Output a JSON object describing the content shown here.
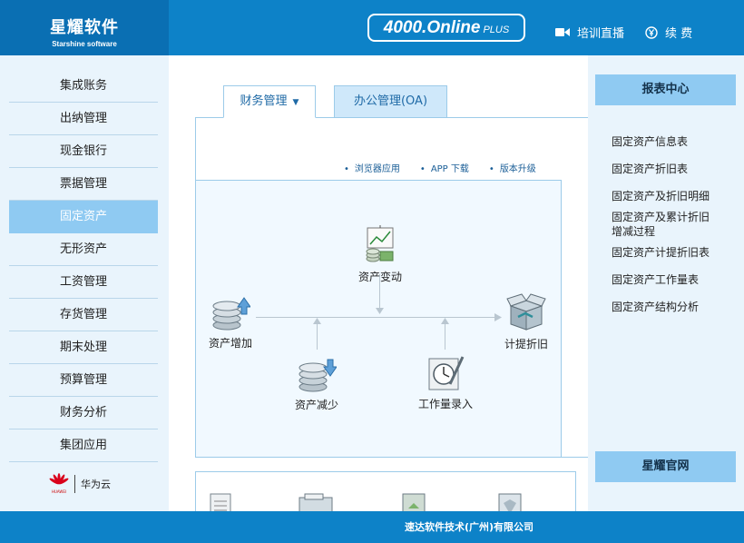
{
  "header": {
    "brand_cn": "星耀软件",
    "brand_en": "Starshine software",
    "online_main": "4000.Online",
    "online_plus": "PLUS",
    "live_label": "培训直播",
    "renew_label": "续 费"
  },
  "sidebar": {
    "items": [
      {
        "label": "集成账务"
      },
      {
        "label": "出纳管理"
      },
      {
        "label": "现金银行"
      },
      {
        "label": "票据管理"
      },
      {
        "label": "固定资产"
      },
      {
        "label": "无形资产"
      },
      {
        "label": "工资管理"
      },
      {
        "label": "存货管理"
      },
      {
        "label": "期末处理"
      },
      {
        "label": "预算管理"
      },
      {
        "label": "财务分析"
      },
      {
        "label": "集团应用"
      }
    ],
    "active_index": 4,
    "partner": "华为云",
    "partner_logo_text": "HUAWEI"
  },
  "tabs": [
    {
      "label": "财务管理"
    },
    {
      "label": "办公管理(OA)"
    }
  ],
  "links": [
    "浏览器应用",
    "APP 下载",
    "版本升级"
  ],
  "flow": {
    "change": "资产变动",
    "add": "资产增加",
    "reduce": "资产减少",
    "workload": "工作量录入",
    "depreciation": "计提折旧"
  },
  "right": {
    "report_center": "报表中心",
    "reports": [
      "固定资产信息表",
      "固定资产折旧表",
      "固定资产及折旧明细",
      "固定资产及累计折旧增减过程",
      "固定资产计提折旧表",
      "固定资产工作量表",
      "固定资产结构分析"
    ],
    "official_site": "星耀官网"
  },
  "footer": {
    "company": "速达软件技术(广州)有限公司"
  },
  "colors": {
    "header_blue": "#0d82c8",
    "brand_blue": "#0a6fb3",
    "active_item": "#8fcaf2",
    "page_bg": "#e9f4fc"
  }
}
